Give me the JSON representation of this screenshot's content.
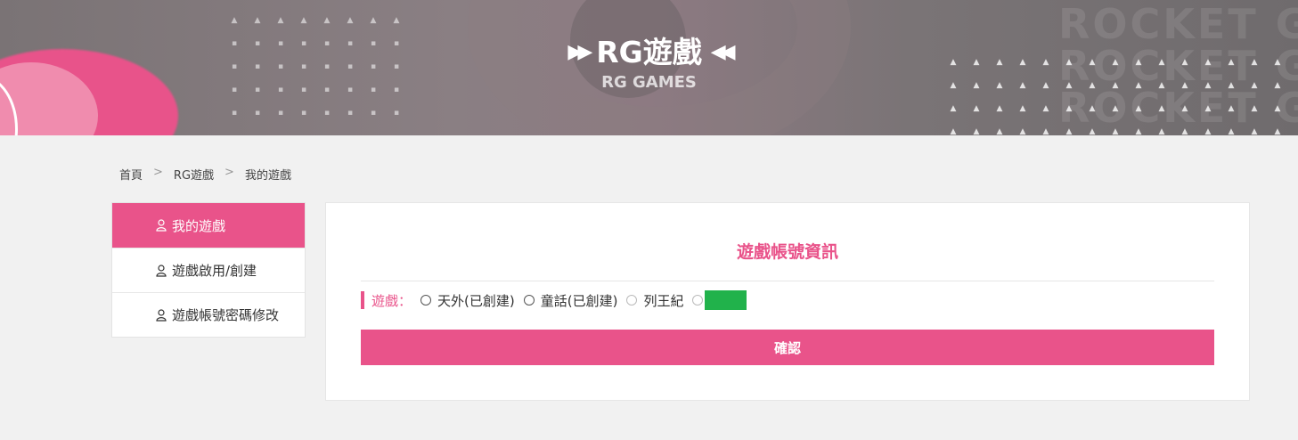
{
  "banner": {
    "title": "RG遊戲",
    "subtitle": "RG GAMES",
    "watermark_text": "ROCKET GAMES",
    "accent_color": "#e9538a"
  },
  "breadcrumb": [
    "首頁",
    "RG遊戲",
    "我的遊戲"
  ],
  "breadcrumb_separator": ">",
  "sidebar": {
    "items": [
      {
        "label": "我的遊戲",
        "icon": "user-icon",
        "active": true
      },
      {
        "label": "遊戲啟用/創建",
        "icon": "user-icon",
        "active": false
      },
      {
        "label": "遊戲帳號密碼修改",
        "icon": "user-icon",
        "active": false
      }
    ]
  },
  "main": {
    "title": "遊戲帳號資訊",
    "game_label": "遊戲：",
    "options": [
      {
        "label": "天外(已創建)",
        "enabled": true
      },
      {
        "label": "童話(已創建)",
        "enabled": true
      },
      {
        "label": "列王紀",
        "enabled": false
      },
      {
        "label": "",
        "enabled": false
      }
    ],
    "confirm_label": "確認"
  }
}
